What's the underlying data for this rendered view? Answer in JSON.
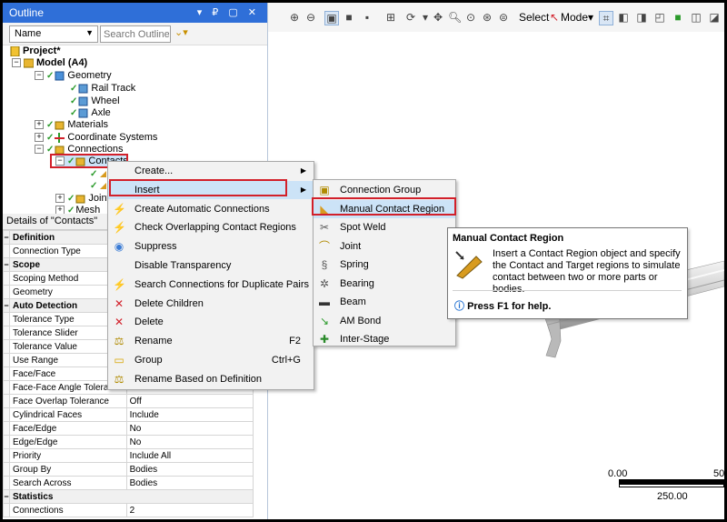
{
  "outline": {
    "title": "Outline",
    "title_buttons": "▾ ₽ ▢ ✕",
    "filter_combo": "Name",
    "search_placeholder": "Search Outline"
  },
  "tree": {
    "project": "Project*",
    "model": "Model (A4)",
    "geometry": "Geometry",
    "rail_track": "Rail Track",
    "wheel": "Wheel",
    "axle": "Axle",
    "materials": "Materials",
    "coordinate_systems": "Coordinate Systems",
    "connections": "Connections",
    "contacts": "Contacts",
    "joints": "Joint",
    "mesh": "Mesh"
  },
  "details": {
    "title": "Details of \"Contacts\"",
    "rows": [
      {
        "group": true,
        "key": "Definition"
      },
      {
        "key": "Connection Type",
        "value": ""
      },
      {
        "group": true,
        "key": "Scope"
      },
      {
        "key": "Scoping Method",
        "value": ""
      },
      {
        "key": "Geometry",
        "value": ""
      },
      {
        "group": true,
        "key": "Auto Detection"
      },
      {
        "key": "Tolerance Type",
        "value": ""
      },
      {
        "key": "Tolerance Slider",
        "value": ""
      },
      {
        "key": "Tolerance Value",
        "value": ""
      },
      {
        "key": "Use Range",
        "value": ""
      },
      {
        "key": "Face/Face",
        "value": ""
      },
      {
        "key": "Face-Face Angle Tolerance",
        "value": "75. °"
      },
      {
        "key": "Face Overlap Tolerance",
        "value": "Off"
      },
      {
        "key": "Cylindrical Faces",
        "value": "Include"
      },
      {
        "key": "Face/Edge",
        "value": "No"
      },
      {
        "key": "Edge/Edge",
        "value": "No"
      },
      {
        "key": "Priority",
        "value": "Include All"
      },
      {
        "key": "Group By",
        "value": "Bodies"
      },
      {
        "key": "Search Across",
        "value": "Bodies"
      },
      {
        "group": true,
        "key": "Statistics"
      },
      {
        "key": "Connections",
        "value": "2"
      }
    ]
  },
  "toolbar": {
    "select_label": "Select",
    "mode_label": "Mode▾"
  },
  "context_menu": {
    "items": [
      {
        "label": "Create...",
        "icon": "",
        "shortcut": "",
        "submenu": true
      },
      {
        "label": "Insert",
        "icon": "",
        "shortcut": "",
        "submenu": true
      },
      {
        "label": "Create Automatic Connections",
        "icon": "lightning-icon",
        "shortcut": ""
      },
      {
        "label": "Check Overlapping Contact Regions",
        "icon": "lightning-icon",
        "shortcut": ""
      },
      {
        "label": "Suppress",
        "icon": "suppress-icon",
        "shortcut": ""
      },
      {
        "label": "Disable Transparency",
        "icon": "",
        "shortcut": ""
      },
      {
        "label": "Search Connections for Duplicate Pairs",
        "icon": "lightning-icon",
        "shortcut": ""
      },
      {
        "label": "Delete Children",
        "icon": "delete-icon",
        "shortcut": ""
      },
      {
        "label": "Delete",
        "icon": "delete-icon",
        "shortcut": ""
      },
      {
        "label": "Rename",
        "icon": "rename-icon",
        "shortcut": "F2"
      },
      {
        "label": "Group",
        "icon": "folder-icon",
        "shortcut": "Ctrl+G"
      },
      {
        "label": "Rename Based on Definition",
        "icon": "rename-icon",
        "shortcut": ""
      }
    ]
  },
  "submenu": {
    "items": [
      {
        "label": "Connection Group",
        "icon": "connection-group-icon"
      },
      {
        "label": "Manual Contact Region",
        "icon": "contact-region-icon"
      },
      {
        "label": "Spot Weld",
        "icon": "spot-weld-icon"
      },
      {
        "label": "Joint",
        "icon": "joint-icon"
      },
      {
        "label": "Spring",
        "icon": "spring-icon"
      },
      {
        "label": "Bearing",
        "icon": "bearing-icon"
      },
      {
        "label": "Beam",
        "icon": "beam-icon"
      },
      {
        "label": "AM Bond",
        "icon": "am-bond-icon"
      },
      {
        "label": "Inter-Stage",
        "icon": "inter-stage-icon"
      }
    ]
  },
  "tooltip": {
    "title": "Manual Contact Region",
    "body": "Insert a Contact Region object and specify the Contact and Target regions to simulate contact between two or more parts or bodies.",
    "help": "Press F1 for help."
  },
  "scale_bar": {
    "label_start": "0.00",
    "label_mid": "50",
    "label_bottom": "250.00"
  },
  "colors": {
    "title_bar": "#2f6fd8",
    "highlight": "#cce3f7",
    "callout_red": "#d2202a"
  }
}
